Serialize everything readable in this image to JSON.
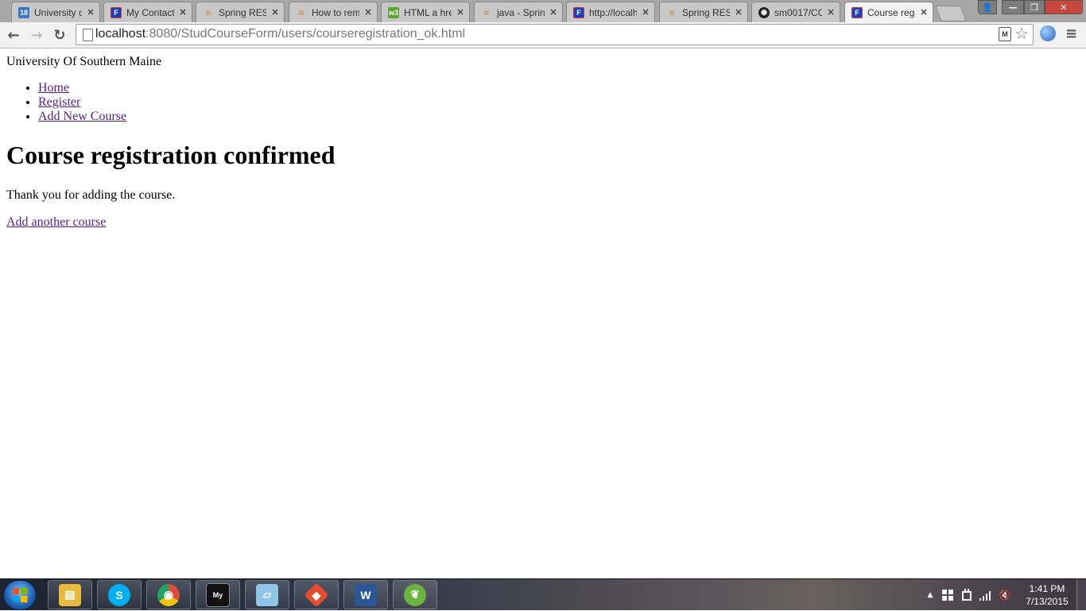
{
  "browser": {
    "tabs": [
      {
        "title": "University o",
        "favicon": "calendar-icon",
        "badge": "18"
      },
      {
        "title": "My Contact",
        "favicon": "jform-icon",
        "badge": "F"
      },
      {
        "title": "Spring REST",
        "favicon": "stackoverflow-icon",
        "badge": "≡"
      },
      {
        "title": "How to rem",
        "favicon": "stackoverflow-icon",
        "badge": "≡"
      },
      {
        "title": "HTML a hre",
        "favicon": "w3schools-icon",
        "badge": "w3"
      },
      {
        "title": "java - Spring",
        "favicon": "stackoverflow-icon",
        "badge": "≡"
      },
      {
        "title": "http://localh",
        "favicon": "jform-icon",
        "badge": "F"
      },
      {
        "title": "Spring REST",
        "favicon": "stackoverflow-icon",
        "badge": "≡"
      },
      {
        "title": "sm0017/CO",
        "favicon": "github-icon",
        "badge": "◉"
      },
      {
        "title": "Course regi",
        "favicon": "jform-icon",
        "badge": "F"
      }
    ],
    "tab_close_glyph": "×",
    "window_controls": {
      "user": "👤",
      "minimize": "—",
      "maximize": "❐",
      "close": "✕"
    },
    "nav": {
      "back": "←",
      "forward": "→",
      "reload": "↻"
    },
    "url_host": "localhost",
    "url_rest": ":8080/StudCourseForm/users/courseregistration_ok.html",
    "extension_badge": "M",
    "star": "☆",
    "menu": "≡"
  },
  "page": {
    "site_name": "University Of Southern Maine",
    "nav_links": [
      "Home",
      "Register",
      "Add New Course"
    ],
    "heading": "Course registration confirmed",
    "message": "Thank you for adding the course.",
    "add_another_link": "Add another course"
  },
  "taskbar": {
    "apps": [
      {
        "name": "file-explorer",
        "color": "#e8b93c",
        "glyph": "▤"
      },
      {
        "name": "skype",
        "color": "#00aff0",
        "glyph": "S"
      },
      {
        "name": "chrome",
        "color": "#dd4b39",
        "glyph": "◉"
      },
      {
        "name": "mysql",
        "color": "#111111",
        "glyph": "My"
      },
      {
        "name": "notepad",
        "color": "#8fc6e8",
        "glyph": "▱"
      },
      {
        "name": "git",
        "color": "#e44c30",
        "glyph": "◆"
      },
      {
        "name": "word",
        "color": "#2b5797",
        "glyph": "W"
      },
      {
        "name": "spring",
        "color": "#6db33f",
        "glyph": "❦"
      }
    ],
    "clock_time": "1:41 PM",
    "clock_date": "7/13/2015",
    "tray": {
      "show_hidden": "▲",
      "volume": "🔇"
    }
  },
  "colors": {
    "link": "#551a8b",
    "tab_active": "#f2f2f2",
    "tab_inactive": "#c8c8c8"
  }
}
